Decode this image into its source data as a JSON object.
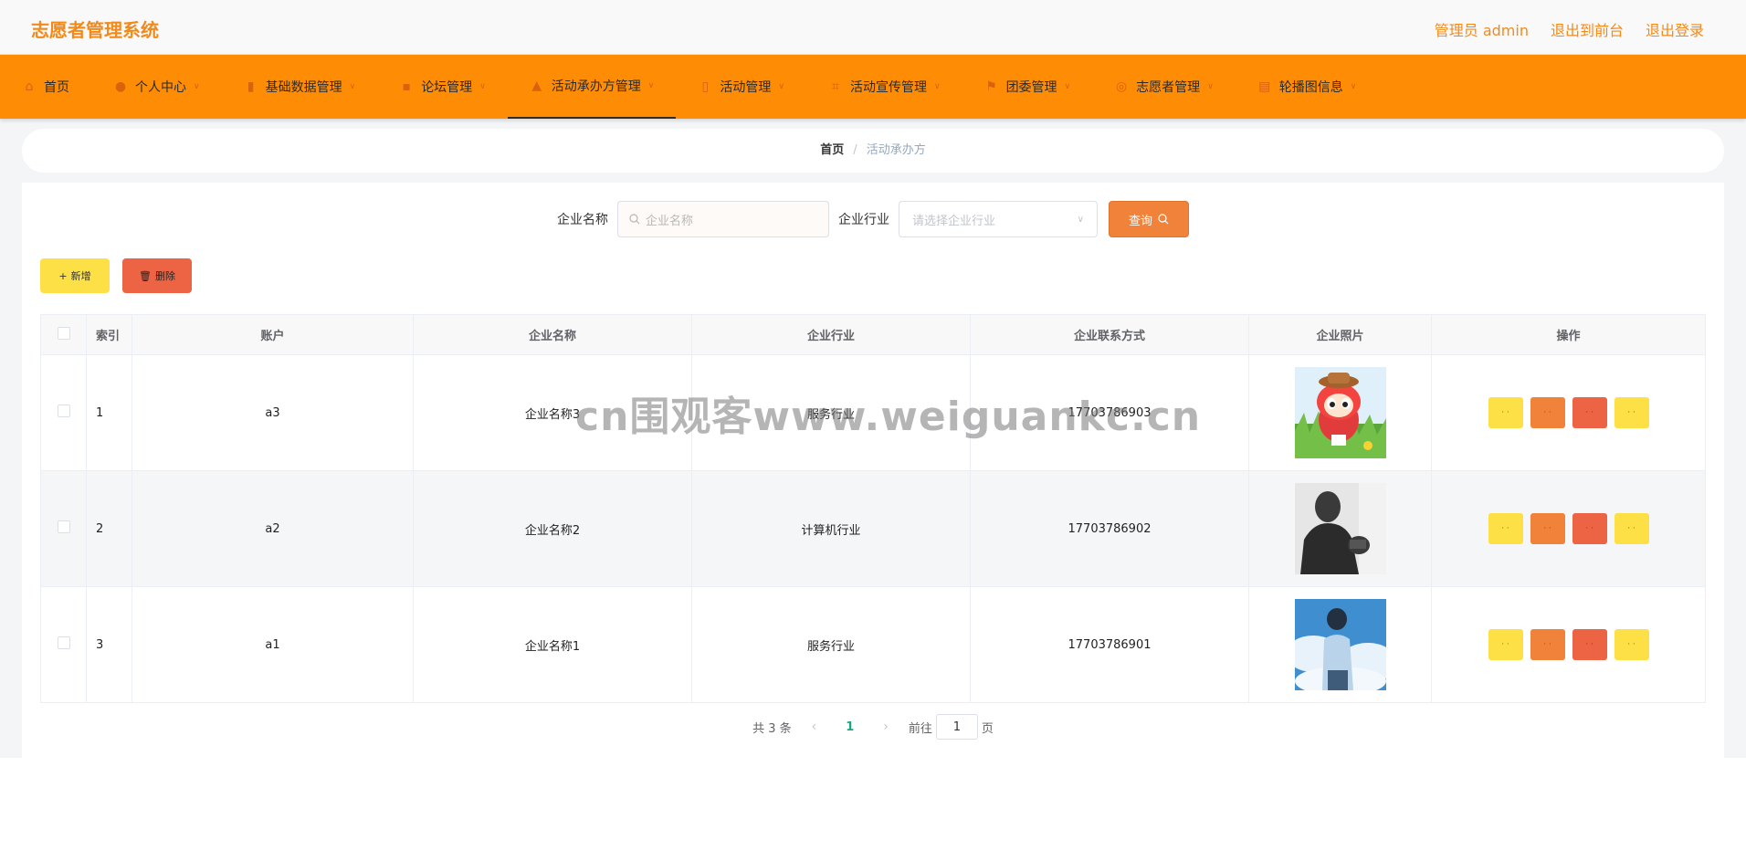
{
  "app": {
    "brand": "志愿者管理系统",
    "admin_label": "管理员 admin",
    "exit_front": "退出到前台",
    "logout": "退出登录"
  },
  "nav": [
    {
      "label": "首页",
      "icon": "home-icon"
    },
    {
      "label": "个人中心",
      "icon": "user-icon"
    },
    {
      "label": "基础数据管理",
      "icon": "bar-chart-icon"
    },
    {
      "label": "论坛管理",
      "icon": "chat-icon"
    },
    {
      "label": "活动承办方管理",
      "icon": "thumb-icon",
      "active": true
    },
    {
      "label": "活动管理",
      "icon": "mic-icon"
    },
    {
      "label": "活动宣传管理",
      "icon": "crop-icon"
    },
    {
      "label": "团委管理",
      "icon": "flag-icon"
    },
    {
      "label": "志愿者管理",
      "icon": "aim-icon"
    },
    {
      "label": "轮播图信息",
      "icon": "clipboard-icon"
    }
  ],
  "breadcrumb": {
    "home": "首页",
    "current": "活动承办方"
  },
  "search": {
    "name_label": "企业名称",
    "name_placeholder": "企业名称",
    "industry_label": "企业行业",
    "industry_placeholder": "请选择企业行业",
    "query_label": "查询"
  },
  "actions": {
    "add": "新增",
    "delete": "删除"
  },
  "table": {
    "headers": [
      "索引",
      "账户",
      "企业名称",
      "企业行业",
      "企业联系方式",
      "企业照片",
      "操作"
    ],
    "rows": [
      {
        "index": "1",
        "account": "a3",
        "name": "企业名称3",
        "industry": "服务行业",
        "phone": "17703786903",
        "photo": "cartoon-cat-photo"
      },
      {
        "index": "2",
        "account": "a2",
        "name": "企业名称2",
        "industry": "计算机行业",
        "phone": "17703786902",
        "photo": "silhouette-man-photo"
      },
      {
        "index": "3",
        "account": "a1",
        "name": "企业名称1",
        "industry": "服务行业",
        "phone": "17703786901",
        "photo": "anime-boy-sky-photo"
      }
    ]
  },
  "pager": {
    "total": "共 3 条",
    "current_page": "1",
    "goto_label": "前往",
    "goto_value": "1",
    "page_suffix": "页"
  },
  "watermark": "cn围观客www.weiguankc.cn",
  "colors": {
    "accent": "#fe8c05",
    "brand_text": "#f28a1a",
    "btn_yellow": "#fce046",
    "btn_orange": "#f0823a",
    "btn_red": "#ec6443"
  }
}
